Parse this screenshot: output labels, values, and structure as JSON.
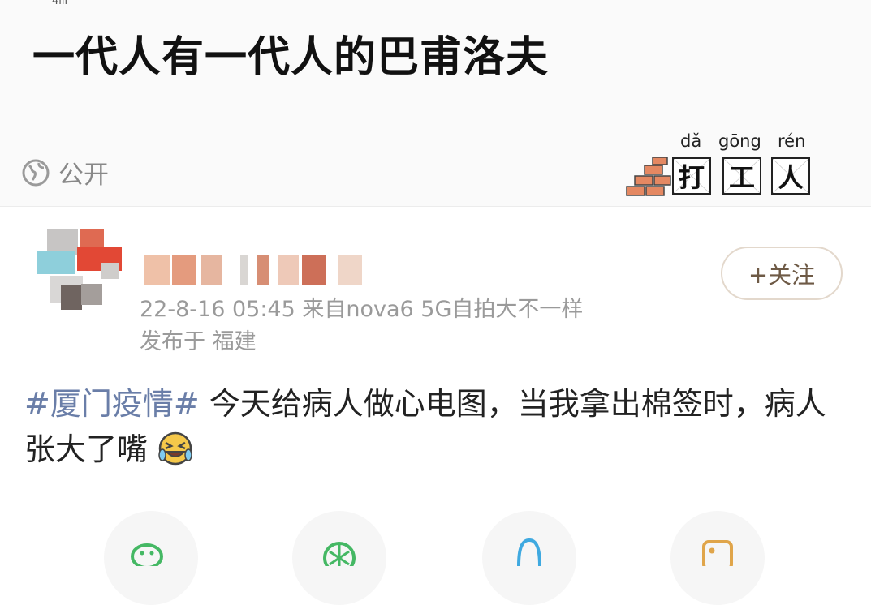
{
  "header": {
    "top_mark": "4ill",
    "title": "一代人有一代人的巴甫洛夫",
    "visibility_label": "公开"
  },
  "sticker": {
    "pinyin": [
      "dǎ",
      "gōng",
      "rén"
    ],
    "characters": [
      "打",
      "工",
      "人"
    ]
  },
  "post": {
    "timestamp_source": "22-8-16 05:45  来自nova6 5G自拍大不一样",
    "location": "发布于 福建",
    "hashtag": "#厦门疫情#",
    "text": " 今天给病人做心电图，当我拿出棉签时，病人张大了嘴",
    "follow_label": "+关注",
    "emoji": "laughing-tears-emoji"
  },
  "actions": {
    "icons": [
      "wechat-icon",
      "moments-icon",
      "qq-icon",
      "image-icon"
    ]
  },
  "colors": {
    "hashtag": "#6a7ea8",
    "follow_text": "#6e5a46",
    "meta": "#9a9a9a"
  }
}
